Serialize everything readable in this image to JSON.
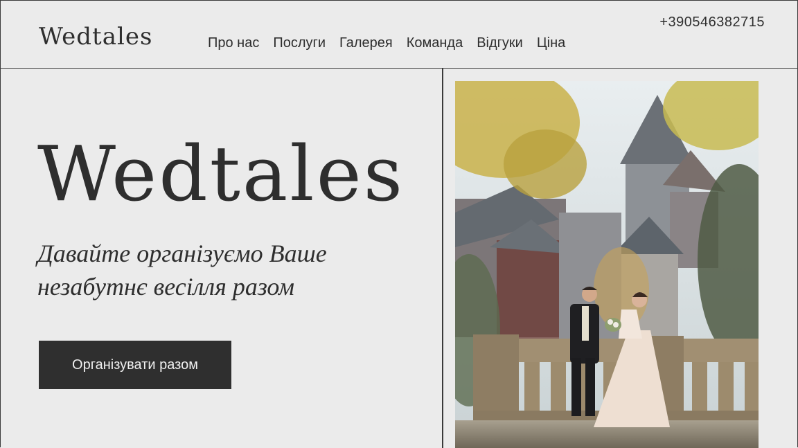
{
  "brand": {
    "logo": "Wedtales"
  },
  "nav": {
    "items": [
      "Про нас",
      "Послуги",
      "Галерея",
      "Команда",
      "Відгуки",
      "Ціна"
    ]
  },
  "contact": {
    "phone": "+390546382715"
  },
  "hero": {
    "title": "Wedtales",
    "tagline": "Давайте організуємо Ваше незабутнє весілля разом",
    "cta_label": "Організувати разом"
  },
  "colors": {
    "background": "#ebebeb",
    "text": "#2e2e2e",
    "button": "#2f2f2f",
    "button_text": "#f0f0f0"
  }
}
